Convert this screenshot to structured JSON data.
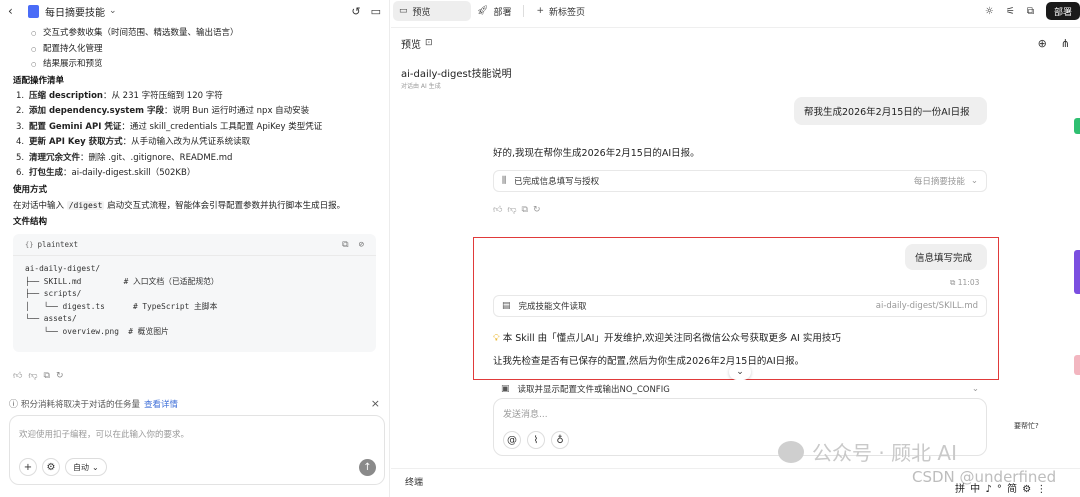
{
  "left": {
    "header": {
      "title": "每日摘要技能"
    },
    "sub_bullets": [
      "交互式参数收集（时间范围、精选数量、输出语言）",
      "配置持久化管理",
      "结果展示和预览"
    ],
    "adapt_heading": "适配操作清单",
    "adapt_items": [
      {
        "n": "1.",
        "bold": "压缩 description",
        "text": "：从 231 字符压缩到 120 字符"
      },
      {
        "n": "2.",
        "bold": "添加 dependency.system 字段",
        "text": "：说明 Bun 运行时通过 npx 自动安装"
      },
      {
        "n": "3.",
        "bold": "配置 Gemini API 凭证",
        "text": "：通过 skill_credentials 工具配置 ApiKey 类型凭证"
      },
      {
        "n": "4.",
        "bold": "更新 API Key 获取方式",
        "text": "：从手动输入改为从凭证系统读取"
      },
      {
        "n": "5.",
        "bold": "清理冗余文件",
        "text": "：删除 .git、.gitignore、README.md"
      },
      {
        "n": "6.",
        "bold": "打包生成",
        "text": "：ai-daily-digest.skill（502KB）"
      }
    ],
    "usage_heading": "使用方式",
    "usage_pre": "在对话中输入 ",
    "usage_code": "/digest",
    "usage_post": " 启动交互式流程，智能体会引导配置参数并执行脚本生成日报。",
    "files_heading": "文件结构",
    "code_lang": "plaintext",
    "code_text": "ai-daily-digest/\n├── SKILL.md         # 入口文档（已适配规范）\n├── scripts/\n│   └── digest.ts      # TypeScript 主脚本\n└── assets/\n    └── overview.png  # 概览图片",
    "credit_notice": "积分消耗将取决于对话的任务量",
    "credit_link": "查看详情",
    "composer_placeholder": "欢迎使用扣子编程，可以在此输入你的要求。",
    "mode_label": "自动"
  },
  "tabs": [
    {
      "label": "预览",
      "icon": "preview-icon"
    },
    {
      "label": "部署",
      "icon": "rocket-icon"
    },
    {
      "label": "新标签页",
      "icon": "plus-icon"
    }
  ],
  "deploy_button": "部署",
  "preview": {
    "header_title": "预览",
    "conv_title": "ai-daily-digest技能说明",
    "conv_sub": "对话由 AI 生成",
    "user_msg_1": "帮我生成2026年2月15日的一份AI日报",
    "ai_reply_1": "好的,我现在帮你生成2026年2月15日的AI日报。",
    "tool_1_label": "已完成信息填写与授权",
    "tool_1_right": "每日摘要技能",
    "user_msg_2": "信息填写完成",
    "timestamp": "11:03",
    "tool_2_label": "完成技能文件读取",
    "tool_2_right": "ai-daily-digest/SKILL.md",
    "promo": "本 Skill 由「懂点儿AI」开发维护,欢迎关注同名微信公众号获取更多 AI 实用技巧",
    "ai_reply_2": "让我先检查是否有已保存的配置,然后为你生成2026年2月15日的AI日报。",
    "tool_3_label": "读取并显示配置文件或输出NO_CONFIG",
    "composer_placeholder": "发送消息...",
    "status": "终端"
  },
  "watermark": {
    "wechat": "公众号 · 顾北 AI",
    "csdn": "CSDN @underfined"
  },
  "help_text": "要帮忙?",
  "ime": "拼 中 ♪ ° 简 ⚙ ⋮"
}
